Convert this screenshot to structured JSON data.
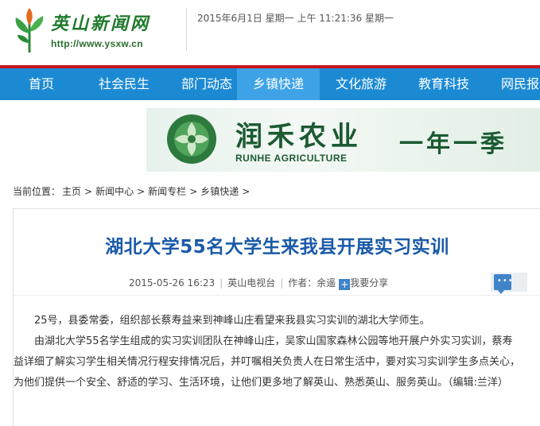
{
  "header": {
    "logo_title": "英山新闻网",
    "logo_url": "http://www.ysxw.cn",
    "datetime": "2015年6月1日 星期一 上午 11:21:36 星期一"
  },
  "nav": {
    "items": [
      {
        "label": "首页"
      },
      {
        "label": "社会民生"
      },
      {
        "label": "部门动态"
      },
      {
        "label": "乡镇快递"
      },
      {
        "label": "文化旅游"
      },
      {
        "label": "教育科技"
      },
      {
        "label": "网民报料"
      }
    ],
    "active": "乡镇快递"
  },
  "banner": {
    "brand": "润禾农业",
    "brand_en": "RUNHE AGRICULTURE",
    "slogan": "一年一季"
  },
  "breadcrumb": {
    "prefix": "当前位置：",
    "items": [
      "主页",
      "新闻中心",
      "新闻专栏",
      "乡镇快递"
    ],
    "separator": ">"
  },
  "article": {
    "title": "湖北大学55名大学生来我县开展实习实训",
    "date": "2015-05-26 16:23",
    "source": "英山电视台",
    "author": "作者：余遥",
    "share_label": "我要分享",
    "paragraphs": [
      "25号，县委常委，组织部长蔡寿益来到神峰山庄看望来我县实习实训的湖北大学师生。",
      "由湖北大学55名学生组成的实习实训团队在神峰山庄，吴家山国家森林公园等地开展户外实习实训，蔡寿益详细了解实习学生相关情况行程安排情况后，并叮嘱相关负责人在日常生活中，要对实习实训学生多点关心，为他们提供一个安全、舒适的学习、生活环境，让他们更多地了解英山、熟悉英山、服务英山。（编辑:兰洋）"
    ]
  },
  "colors": {
    "nav_bg": "#1c8ad3",
    "nav_active": "#3ea3e6",
    "red_line": "#c8161d",
    "title": "#1a5aa8",
    "brand_green": "#1b5a32"
  },
  "icons": {
    "logo": "leaf-logo-icon",
    "banner": "flower-logo-icon",
    "share": "plus-share-icon",
    "comment": "comment-icon"
  }
}
